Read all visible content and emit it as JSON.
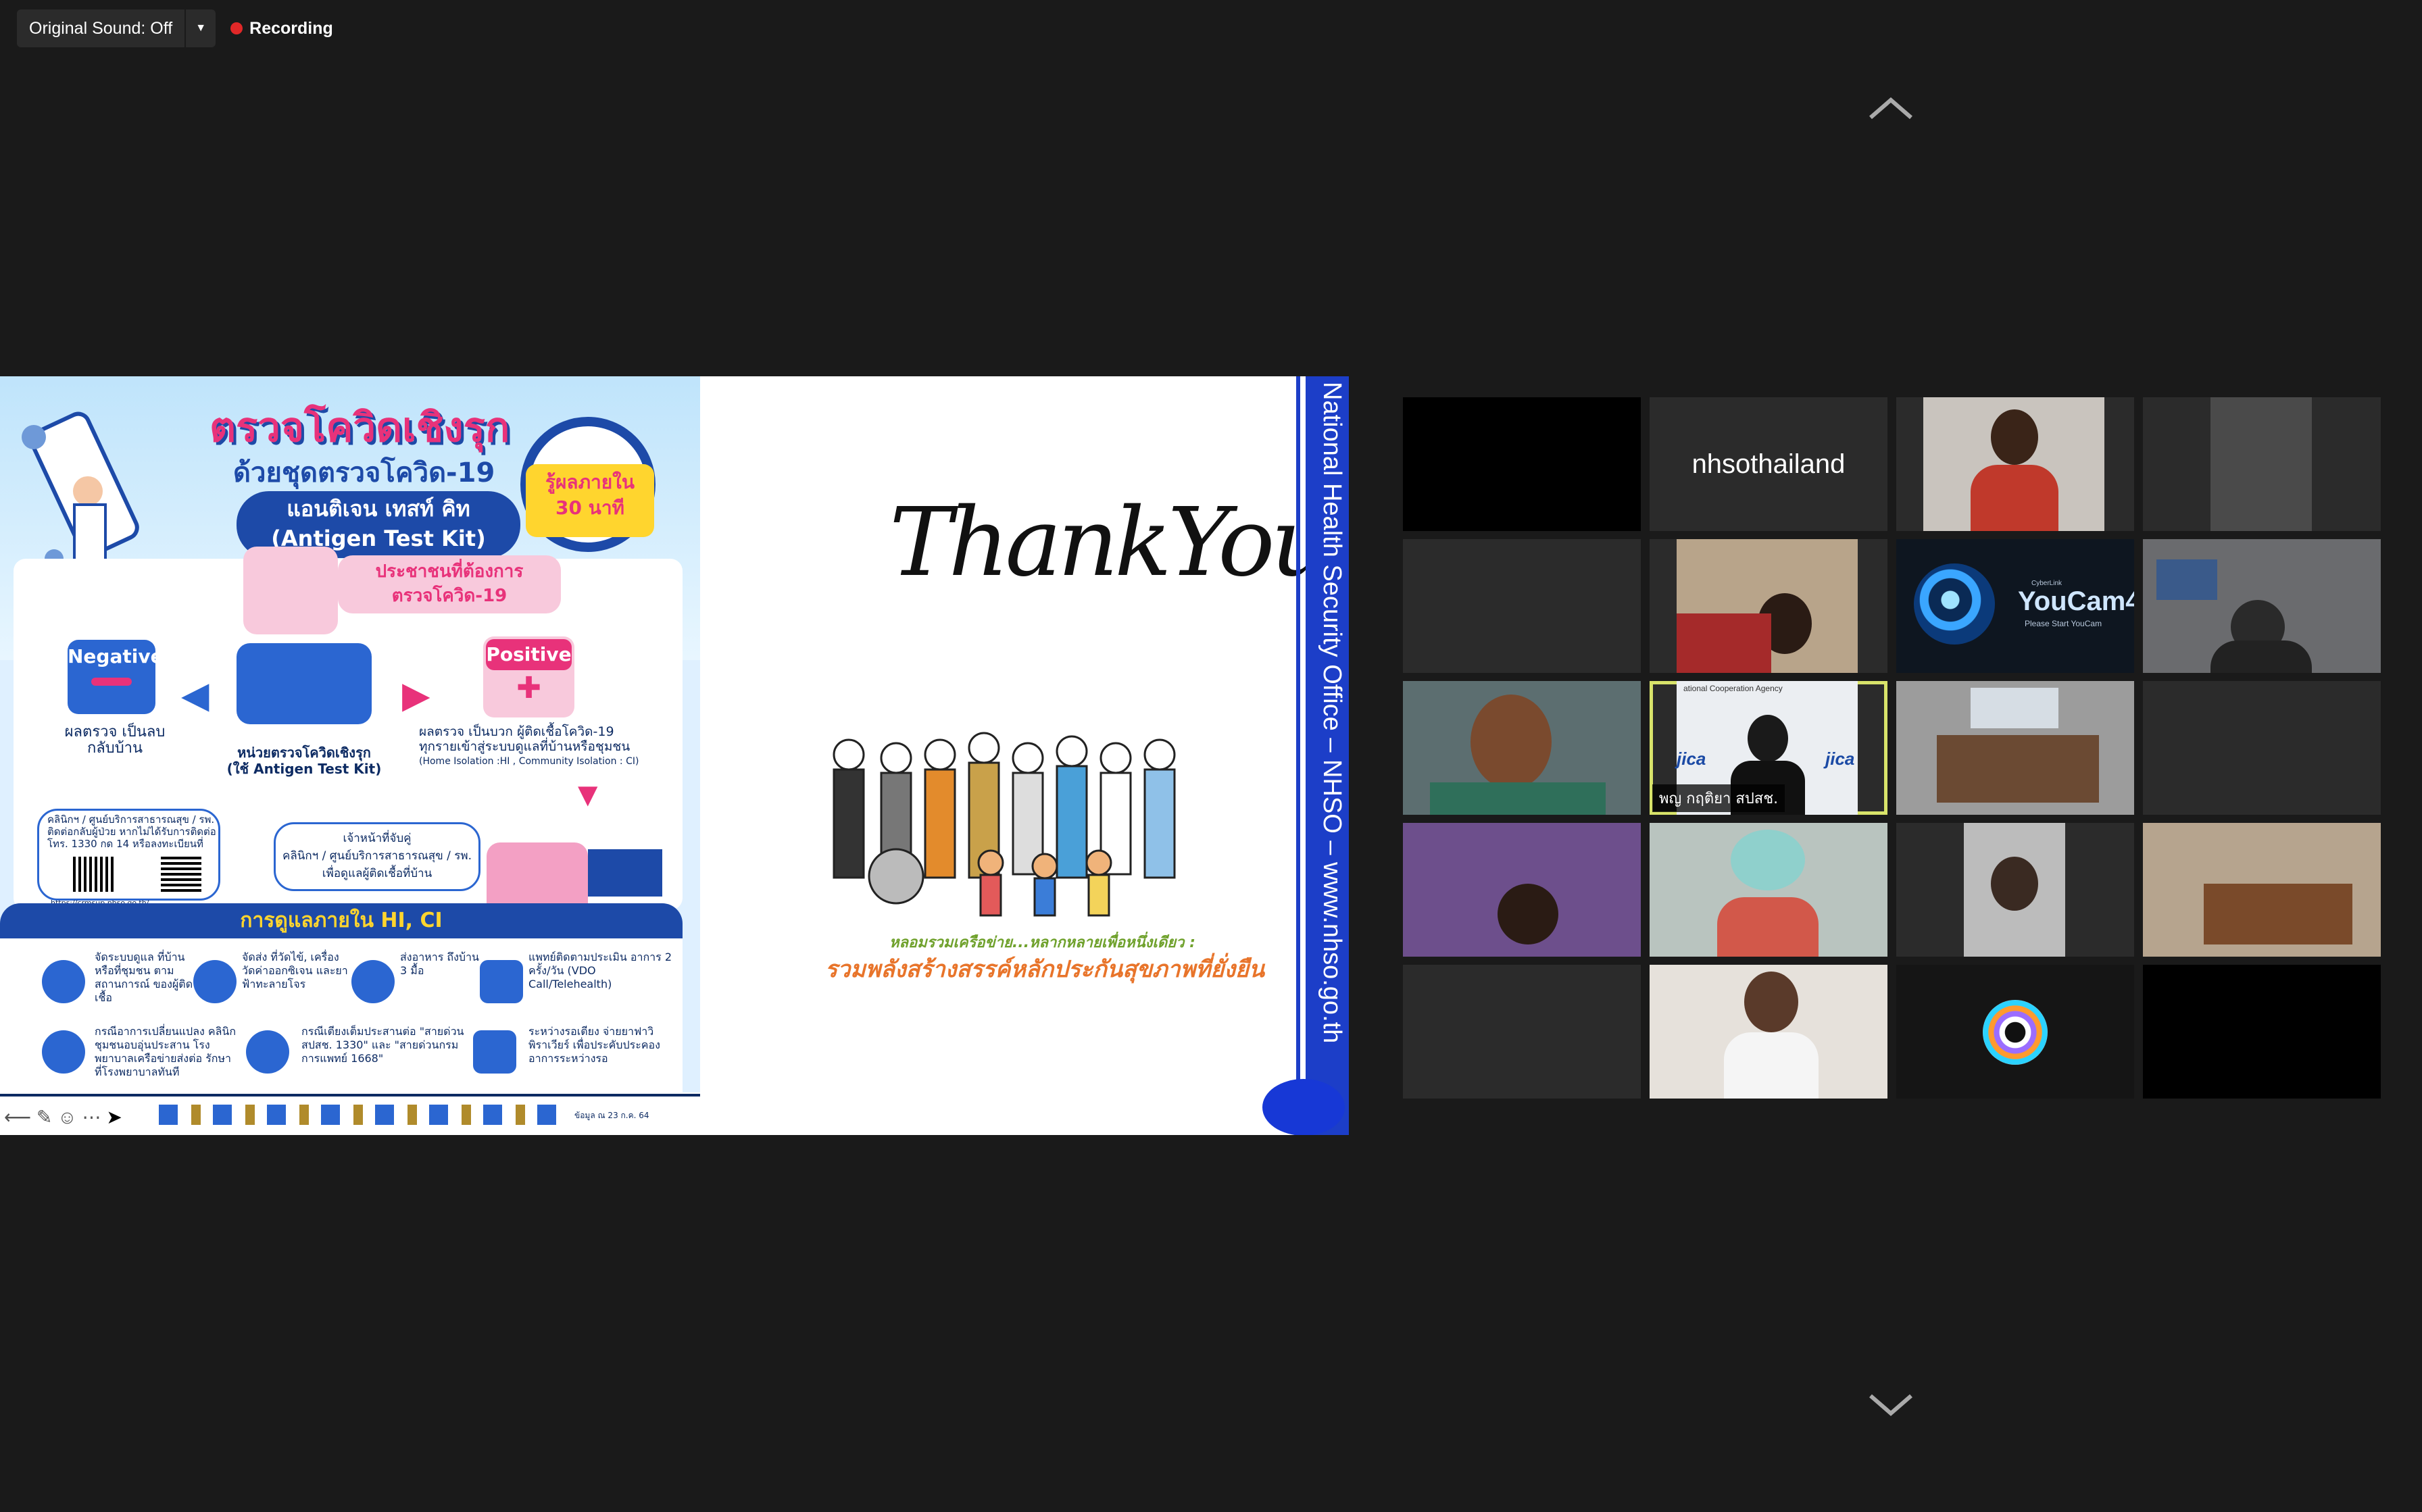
{
  "toolbar": {
    "original_sound_label": "Original Sound: Off",
    "recording_label": "Recording"
  },
  "colors": {
    "background": "#1a1a1a",
    "recording_dot": "#e02828",
    "active_speaker_border": "#d8e36a",
    "nhso_blue": "#1c3ec8"
  },
  "icons": {
    "scroll_up": "chevron-up-icon",
    "scroll_down": "chevron-down-icon",
    "dropdown": "caret-down-icon"
  },
  "slide": {
    "poster": {
      "title": "ตรวจโควิดเชิงรุก",
      "subtitle": "ด้วยชุดตรวจโควิด-19",
      "kit_name": "แอนติเจน เทสท์ คิท",
      "kit_name_en": "(Antigen Test Kit)",
      "result_time": "รู้ผลภายใน",
      "result_time_2": "30 นาที",
      "people_label": "ประชาชนที่ต้องการ",
      "people_label_2": "ตรวจโควิด-19",
      "negative_label": "Negative",
      "positive_label": "Positive",
      "negative_result": "ผลตรวจ เป็นลบ",
      "negative_result_2": "กลับบ้าน",
      "unit_label": "หน่วยตรวจโควิดเชิงรุก",
      "unit_label_2": "(ใช้ Antigen Test Kit)",
      "positive_result": "ผลตรวจ เป็นบวก ผู้ติดเชื้อโควิด-19",
      "positive_result_2": "ทุกรายเข้าสู่ระบบดูแลที่บ้านหรือชุมชน",
      "positive_result_3": "(Home Isolation :HI , Community Isolation : CI)",
      "clinic_text": "คลินิกฯ / ศูนย์บริการสาธารณสุข / รพ.",
      "clinic_text_2": "ติดต่อกลับผู้ป่วย หากไม่ได้รับการติดต่อ",
      "clinic_text_3": "โทร. 1330 กด 14 หรือลงทะเบียนที่",
      "clinic_url": "https://crmsup.nhso.go.th/",
      "staff_text": "เจ้าหน้าที่จับคู่",
      "staff_text_2": "คลินิกฯ / ศูนย์บริการสาธารณสุข / รพ.",
      "staff_text_3": "เพื่อดูแลผู้ติดเชื้อที่บ้าน",
      "care_band": "การดูแลภายใน HI, CI",
      "care_items": [
        "จัดระบบดูแล ที่บ้านหรือที่ชุมชน ตามสถานการณ์ ของผู้ติดเชื้อ",
        "จัดส่ง ที่วัดไข้, เครื่องวัดค่าออกซิเจน และยาฟ้าทะลายโจร",
        "ส่งอาหาร ถึงบ้าน 3 มื้อ",
        "แพทย์ติดตามประเมิน อาการ 2 ครั้ง/วัน (VDO Call/Telehealth)",
        "กรณีอาการเปลี่ยนแปลง คลินิกชุมชนอบอุ่นประสาน โรงพยาบาลเครือข่ายส่งต่อ รักษาที่โรงพยาบาลทันที",
        "กรณีเตียงเต็มประสานต่อ \"สายด่วน สปสช. 1330\" และ \"สายด่วนกรมการแพทย์ 1668\"",
        "ระหว่างรอเตียง จ่ายยาฟาวิพิราเวียร์ เพื่อประคับประคอง อาการระหว่างรอ"
      ],
      "date_note": "ข้อมูล ณ 23 ก.ค. 64"
    },
    "thank_you": "ThankYou",
    "caption_small": "หลอมรวมเครือข่าย...หลากหลายเพื่อหนึ่งเดียว :",
    "caption_main": "รวมพลังสร้างสรรค์หลักประกันสุขภาพที่ยั่งยืน",
    "side_text": "National Health Security Office – NHSO – www.nhso.go.th"
  },
  "gallery": {
    "tiles": [
      {
        "name": ""
      },
      {
        "name": "nhsothailand"
      },
      {
        "name": ""
      },
      {
        "name": ""
      },
      {
        "name": ""
      },
      {
        "name": ""
      },
      {
        "name": "YouCam4",
        "sub": "Please Start YouCam",
        "tiny": "CyberLink"
      },
      {
        "name": ""
      },
      {
        "name": ""
      },
      {
        "name": "พญ กฤติยา สปสช.",
        "overlay": "ational Cooperation Agency",
        "logo": "jica"
      },
      {
        "name": ""
      },
      {
        "name": ""
      },
      {
        "name": ""
      },
      {
        "name": ""
      },
      {
        "name": ""
      },
      {
        "name": ""
      },
      {
        "name": ""
      },
      {
        "name": ""
      },
      {
        "name": ""
      }
    ]
  }
}
